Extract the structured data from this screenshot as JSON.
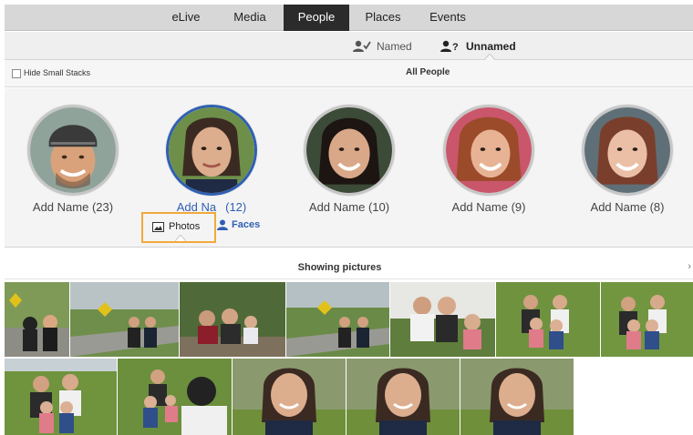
{
  "nav": {
    "tabs": [
      {
        "label": "eLive"
      },
      {
        "label": "Media"
      },
      {
        "label": "People",
        "active": true
      },
      {
        "label": "Places"
      },
      {
        "label": "Events"
      }
    ]
  },
  "subnav": {
    "named_label": "Named",
    "unnamed_label": "Unnamed",
    "selected": "Unnamed"
  },
  "filter": {
    "hide_small_stacks_label": "Hide Small Stacks",
    "hide_small_stacks_checked": false,
    "scope_label": "All People"
  },
  "people": [
    {
      "name": "Add Name",
      "count": "(23)"
    },
    {
      "name": "Add Na",
      "count": "(12)",
      "selected": true
    },
    {
      "name": "Add Name",
      "count": "(10)"
    },
    {
      "name": "Add Name",
      "count": "(9)"
    },
    {
      "name": "Add Name",
      "count": "(8)"
    }
  ],
  "view_toggle": {
    "photos_label": "Photos",
    "faces_label": "Faces",
    "selected": "Photos"
  },
  "results": {
    "showing_label": "Showing pictures",
    "chevron": "›"
  },
  "colors": {
    "accent": "#2f5fb3",
    "highlight": "#f2a93b",
    "active_tab_bg": "#2b2b2b"
  },
  "icons": {
    "named": "person-check-icon",
    "unnamed": "person-question-icon",
    "photos": "photo-icon",
    "faces": "person-icon"
  }
}
